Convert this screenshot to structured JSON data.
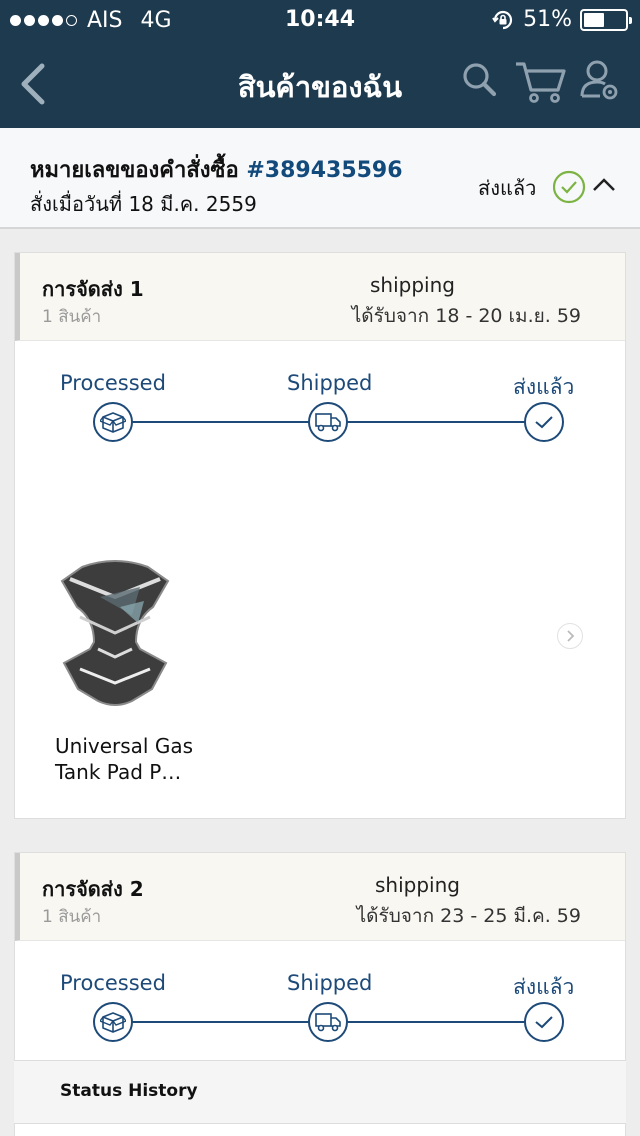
{
  "status_bar": {
    "carrier": "AIS",
    "network": "4G",
    "time": "10:44",
    "battery": "51%",
    "battery_level": 0.51
  },
  "nav": {
    "title": "สินค้าของฉัน",
    "icons": [
      "back-icon",
      "search-icon",
      "cart-icon",
      "account-settings-icon"
    ]
  },
  "order": {
    "label": "หมายเลขของคำสั่งซื้อ",
    "number": "#389435596",
    "date": "สั่งเมื่อวันที่ 18 มี.ค. 2559",
    "status": "ส่งแล้ว"
  },
  "shipments": [
    {
      "title": "การจัดส่ง 1",
      "count": "1 สินค้า",
      "method": "shipping",
      "delivery": "ได้รับจาก 18 - 20 เม.ย. 59",
      "steps": [
        "Processed",
        "Shipped",
        "ส่งแล้ว"
      ],
      "product_name": "Universal Gas Tank Pad P…"
    },
    {
      "title": "การจัดส่ง 2",
      "count": "1 สินค้า",
      "method": "shipping",
      "delivery": "ได้รับจาก 23 - 25 มี.ค. 59",
      "steps": [
        "Processed",
        "Shipped",
        "ส่งแล้ว"
      ]
    }
  ],
  "status_history": "Status History",
  "colors": {
    "navy": "#1e3a4f",
    "accent_blue": "#1d4a78",
    "order_number": "#124a7c",
    "check_green": "#7cb342"
  }
}
